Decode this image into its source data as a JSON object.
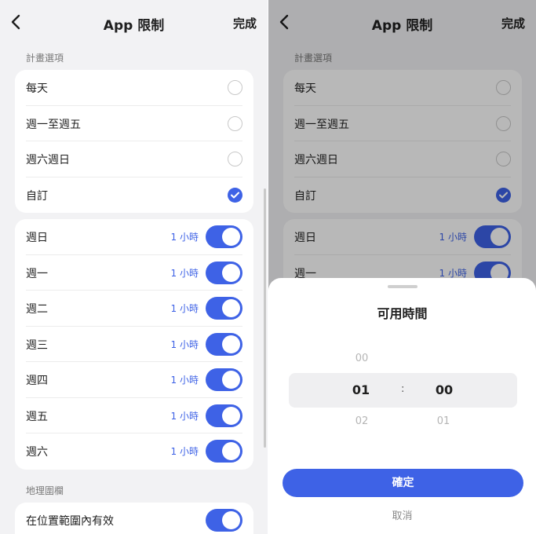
{
  "header": {
    "title": "App 限制",
    "done_label": "完成"
  },
  "plan": {
    "section_label": "計畫選項",
    "options": [
      {
        "label": "每天",
        "selected": false
      },
      {
        "label": "週一至週五",
        "selected": false
      },
      {
        "label": "週六週日",
        "selected": false
      },
      {
        "label": "自訂",
        "selected": true
      }
    ]
  },
  "days": [
    {
      "label": "週日",
      "time": "1 小時",
      "enabled": true
    },
    {
      "label": "週一",
      "time": "1 小時",
      "enabled": true
    },
    {
      "label": "週二",
      "time": "1 小時",
      "enabled": true
    },
    {
      "label": "週三",
      "time": "1 小時",
      "enabled": true
    },
    {
      "label": "週四",
      "time": "1 小時",
      "enabled": true
    },
    {
      "label": "週五",
      "time": "1 小時",
      "enabled": true
    },
    {
      "label": "週六",
      "time": "1 小時",
      "enabled": true
    }
  ],
  "geofence": {
    "section_label": "地理圍欄",
    "label": "在位置範圍內有效",
    "enabled": true
  },
  "sheet": {
    "title": "可用時間",
    "hours": {
      "prev": "00",
      "selected": "01",
      "next": "02"
    },
    "separator": ":",
    "minutes": {
      "selected": "00",
      "next": "01"
    },
    "confirm_label": "確定",
    "cancel_label": "取消"
  },
  "colors": {
    "accent": "#3e62e6",
    "background": "#f2f2f4"
  }
}
